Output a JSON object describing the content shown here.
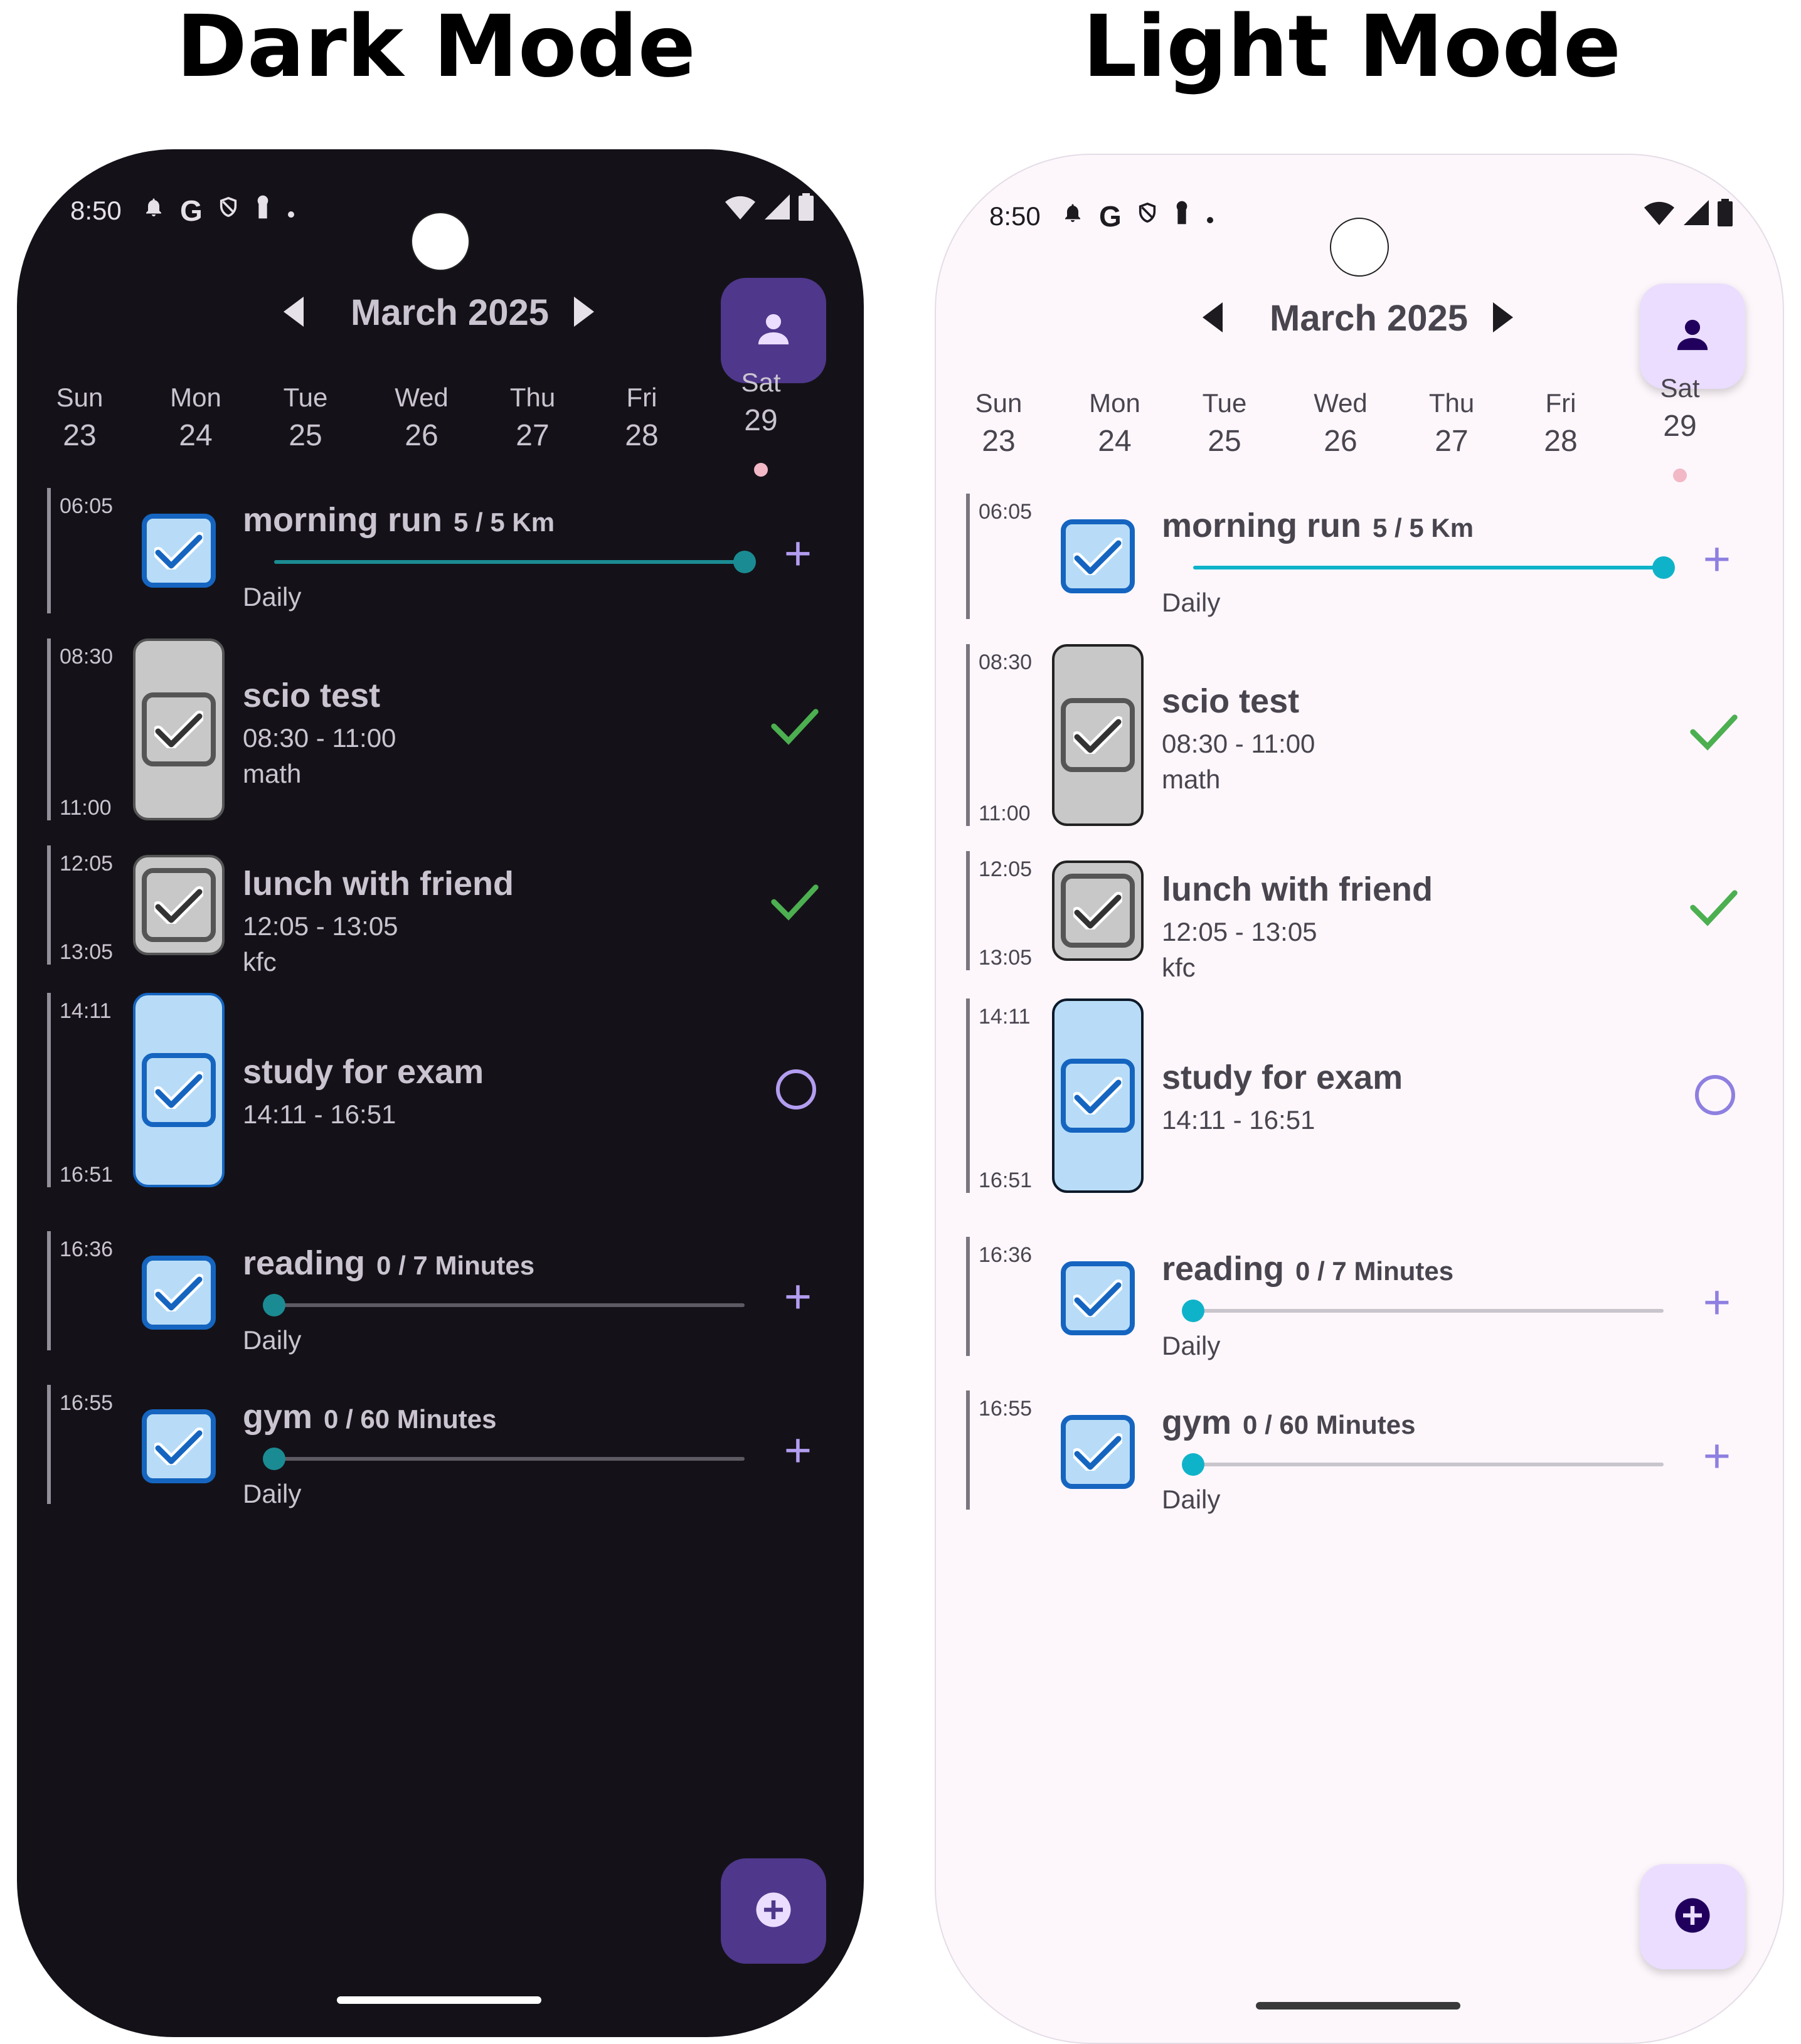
{
  "titles": {
    "dark": "Dark Mode",
    "light": "Light Mode"
  },
  "status": {
    "time": "8:50",
    "icons": [
      "bell-icon",
      "google-icon",
      "shield-icon",
      "keyhole-icon",
      "dot-icon",
      "wifi-icon",
      "signal-icon",
      "battery-icon"
    ]
  },
  "header": {
    "month": "March 2025",
    "prev_icon": "chevron-left-icon",
    "next_icon": "chevron-right-icon",
    "profile_icon": "person-icon"
  },
  "days": [
    {
      "name": "Sun",
      "date": "23"
    },
    {
      "name": "Mon",
      "date": "24"
    },
    {
      "name": "Tue",
      "date": "25"
    },
    {
      "name": "Wed",
      "date": "26"
    },
    {
      "name": "Thu",
      "date": "27"
    },
    {
      "name": "Fri",
      "date": "28"
    },
    {
      "name": "Sat",
      "date": "29"
    }
  ],
  "tasks": [
    {
      "name": "morning run",
      "qty": "5 / 5 Km",
      "sub": "Daily",
      "start": "06:05",
      "end": "",
      "progress": 1.0,
      "action": "+"
    },
    {
      "name": "scio test",
      "time": "08:30 - 11:00",
      "sub": "math",
      "start": "08:30",
      "end": "11:00"
    },
    {
      "name": "lunch with friend",
      "time": "12:05 - 13:05",
      "sub": "kfc",
      "start": "12:05",
      "end": "13:05"
    },
    {
      "name": "study for exam",
      "time": "14:11 - 16:51",
      "start": "14:11",
      "end": "16:51"
    },
    {
      "name": "reading",
      "qty": "0 / 7 Minutes",
      "sub": "Daily",
      "start": "16:36",
      "end": "",
      "progress": 0.0,
      "action": "+"
    },
    {
      "name": "gym",
      "qty": "0 / 60 Minutes",
      "sub": "Daily",
      "start": "16:55",
      "end": "",
      "progress": 0.0,
      "action": "+"
    }
  ],
  "fab": {
    "icon": "add-circle-icon"
  },
  "colors": {
    "dark_bg": "#141218",
    "light_bg": "#fdf7fc",
    "accent": "#b39df0",
    "done_green": "#4caf50",
    "thumb_teal": "#1b8b93",
    "thumb_cyan": "#0fb3c9"
  }
}
